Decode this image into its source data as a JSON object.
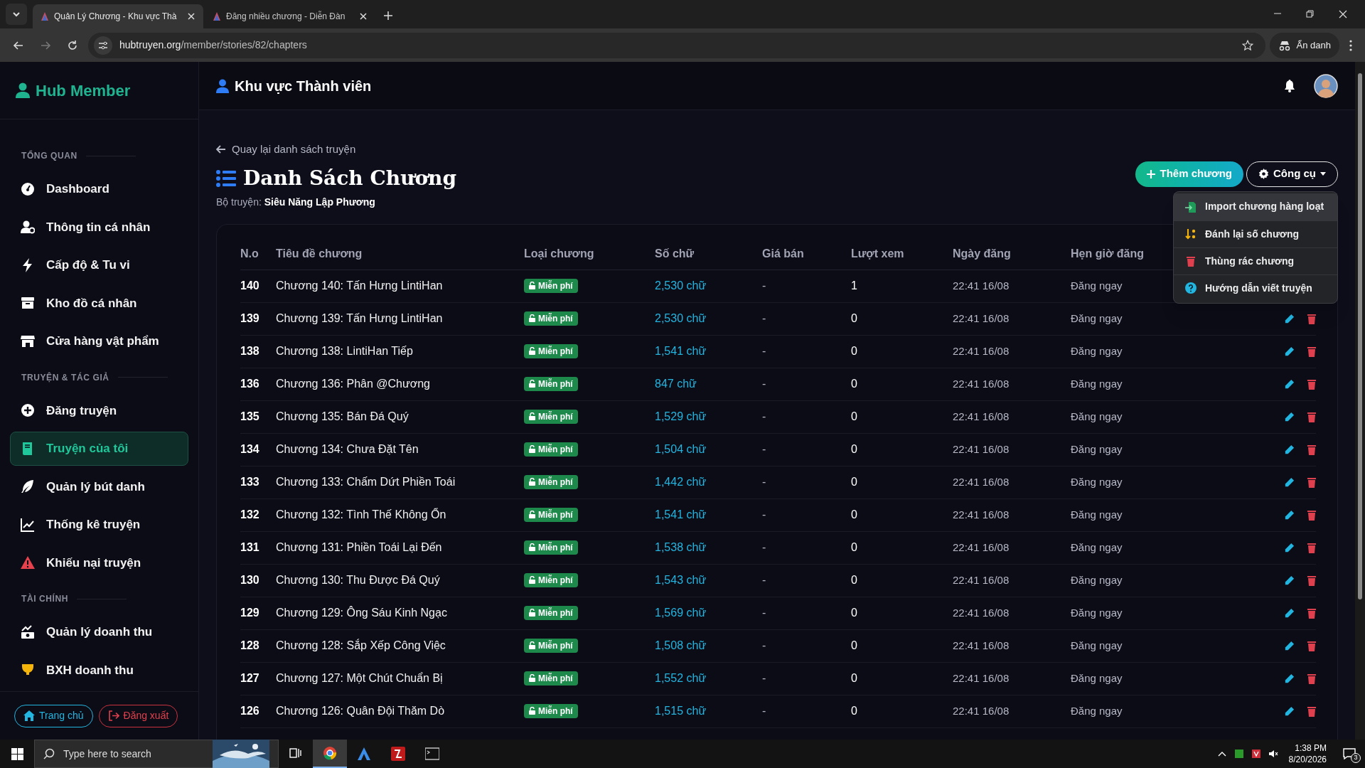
{
  "browser": {
    "tabs": [
      {
        "title": "Quản Lý Chương - Khu vực Thà",
        "selected": true
      },
      {
        "title": "Đăng nhiều chương - Diễn Đàn",
        "selected": false
      }
    ],
    "url_host": "hubtruyen.org",
    "url_path": "/member/stories/82/chapters",
    "profile_label": "Ẩn danh"
  },
  "sidebar": {
    "brand": "Hub Member",
    "sections": [
      {
        "title": "TỔNG QUAN",
        "items": [
          {
            "label": "Dashboard",
            "selected": false
          },
          {
            "label": "Thông tin cá nhân",
            "selected": false
          },
          {
            "label": "Cấp độ & Tu vi",
            "selected": false
          },
          {
            "label": "Kho đồ cá nhân",
            "selected": false
          },
          {
            "label": "Cửa hàng vật phẩm",
            "selected": false
          }
        ]
      },
      {
        "title": "TRUYỆN & TÁC GIẢ",
        "items": [
          {
            "label": "Đăng truyện",
            "selected": false
          },
          {
            "label": "Truyện của tôi",
            "selected": true
          },
          {
            "label": "Quản lý bút danh",
            "selected": false
          },
          {
            "label": "Thống kê truyện",
            "selected": false
          },
          {
            "label": "Khiếu nại truyện",
            "selected": false
          }
        ]
      },
      {
        "title": "TÀI CHÍNH",
        "items": [
          {
            "label": "Quản lý doanh thu",
            "selected": false
          },
          {
            "label": "BXH doanh thu",
            "selected": false
          }
        ]
      }
    ],
    "footer_buttons": [
      {
        "label": "Trang chủ",
        "kind": "home"
      },
      {
        "label": "Đăng xuất",
        "kind": "logout"
      }
    ]
  },
  "header": {
    "title": "Khu vực Thành viên"
  },
  "page": {
    "back_link": "Quay lại danh sách truyện",
    "title": "Danh Sách Chương",
    "story_label": "Bộ truyện:",
    "story_name": "Siêu Năng Lập Phương",
    "add_button": "Thêm chương",
    "tools_button": "Công cụ"
  },
  "tools_menu": {
    "items": [
      {
        "label": "Import chương hàng loạt",
        "selected": true
      },
      {
        "label": "Đánh lại số chương",
        "selected": false
      },
      {
        "label": "Thùng rác chương",
        "selected": false
      },
      {
        "label": "Hướng dẫn viết truyện",
        "selected": false
      }
    ]
  },
  "table": {
    "columns": [
      "N.o",
      "Tiêu đề chương",
      "Loại chương",
      "Số chữ",
      "Giá bán",
      "Lượt xem",
      "Ngày đăng",
      "Hẹn giờ đăng"
    ],
    "rows": [
      {
        "no": "140",
        "title": "Chương 140: Tấn Hưng LintiHan",
        "type": "Miễn phí",
        "words": "2,530 chữ",
        "price": "-",
        "views": "1",
        "date": "22:41 16/08",
        "schedule": "Đăng ngay"
      },
      {
        "no": "139",
        "title": "Chương 139: Tấn Hưng LintiHan",
        "type": "Miễn phí",
        "words": "2,530 chữ",
        "price": "-",
        "views": "0",
        "date": "22:41 16/08",
        "schedule": "Đăng ngay"
      },
      {
        "no": "138",
        "title": "Chương 138: LintiHan Tiếp",
        "type": "Miễn phí",
        "words": "1,541 chữ",
        "price": "-",
        "views": "0",
        "date": "22:41 16/08",
        "schedule": "Đăng ngay"
      },
      {
        "no": "136",
        "title": "Chương 136: Phân @Chương",
        "type": "Miễn phí",
        "words": "847 chữ",
        "price": "-",
        "views": "0",
        "date": "22:41 16/08",
        "schedule": "Đăng ngay"
      },
      {
        "no": "135",
        "title": "Chương 135: Bán Đá Quý",
        "type": "Miễn phí",
        "words": "1,529 chữ",
        "price": "-",
        "views": "0",
        "date": "22:41 16/08",
        "schedule": "Đăng ngay"
      },
      {
        "no": "134",
        "title": "Chương 134: Chưa Đặt Tên",
        "type": "Miễn phí",
        "words": "1,504 chữ",
        "price": "-",
        "views": "0",
        "date": "22:41 16/08",
        "schedule": "Đăng ngay"
      },
      {
        "no": "133",
        "title": "Chương 133: Chấm Dứt Phiền Toái",
        "type": "Miễn phí",
        "words": "1,442 chữ",
        "price": "-",
        "views": "0",
        "date": "22:41 16/08",
        "schedule": "Đăng ngay"
      },
      {
        "no": "132",
        "title": "Chương 132: Tình Thế Không Ổn",
        "type": "Miễn phí",
        "words": "1,541 chữ",
        "price": "-",
        "views": "0",
        "date": "22:41 16/08",
        "schedule": "Đăng ngay"
      },
      {
        "no": "131",
        "title": "Chương 131: Phiền Toái Lại Đến",
        "type": "Miễn phí",
        "words": "1,538 chữ",
        "price": "-",
        "views": "0",
        "date": "22:41 16/08",
        "schedule": "Đăng ngay"
      },
      {
        "no": "130",
        "title": "Chương 130: Thu Được Đá Quý",
        "type": "Miễn phí",
        "words": "1,543 chữ",
        "price": "-",
        "views": "0",
        "date": "22:41 16/08",
        "schedule": "Đăng ngay"
      },
      {
        "no": "129",
        "title": "Chương 129: Ông Sáu Kinh Ngạc",
        "type": "Miễn phí",
        "words": "1,569 chữ",
        "price": "-",
        "views": "0",
        "date": "22:41 16/08",
        "schedule": "Đăng ngay"
      },
      {
        "no": "128",
        "title": "Chương 128: Sắp Xếp Công Việc",
        "type": "Miễn phí",
        "words": "1,508 chữ",
        "price": "-",
        "views": "0",
        "date": "22:41 16/08",
        "schedule": "Đăng ngay"
      },
      {
        "no": "127",
        "title": "Chương 127: Một Chút Chuẩn Bị",
        "type": "Miễn phí",
        "words": "1,552 chữ",
        "price": "-",
        "views": "0",
        "date": "22:41 16/08",
        "schedule": "Đăng ngay"
      },
      {
        "no": "126",
        "title": "Chương 126: Quân Đội Thăm Dò",
        "type": "Miễn phí",
        "words": "1,515 chữ",
        "price": "-",
        "views": "0",
        "date": "22:41 16/08",
        "schedule": "Đăng ngay"
      }
    ]
  },
  "taskbar": {
    "search_placeholder": "Type here to search",
    "time": "1:38 PM",
    "date": "8/20/2026",
    "notification_count": "3"
  }
}
